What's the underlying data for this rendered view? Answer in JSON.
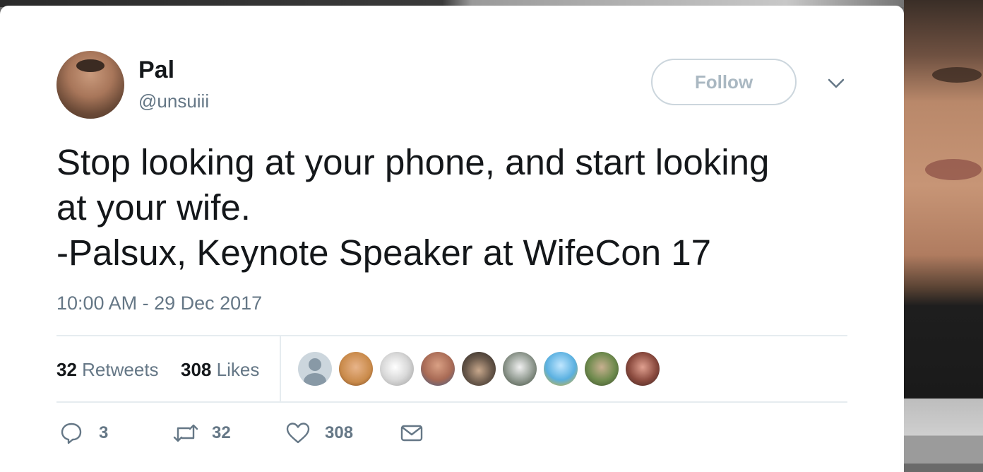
{
  "tweet": {
    "display_name": "Pal",
    "handle": "@unsuiii",
    "follow_label": "Follow",
    "text": "Stop looking at your phone, and start looking\nat your wife.\n-Palsux, Keynote Speaker at WifeCon 17",
    "timestamp": "10:00 AM - 29 Dec 2017"
  },
  "stats": {
    "retweets_count": "32",
    "retweets_label": "Retweets",
    "likes_count": "308",
    "likes_label": "Likes"
  },
  "likers": [
    {
      "avatar": "default-profile",
      "color": "#ccd6dd"
    },
    {
      "avatar": "face-1",
      "color": "#c98a4a"
    },
    {
      "avatar": "sketch-drawing",
      "color": "#d8d8d8"
    },
    {
      "avatar": "face-2",
      "color": "#a86a55"
    },
    {
      "avatar": "face-cap",
      "color": "#4a4540"
    },
    {
      "avatar": "cartoon-bw",
      "color": "#7d8a7a"
    },
    {
      "avatar": "cartoon-blue",
      "color": "#5ab0e0"
    },
    {
      "avatar": "outdoor-photo",
      "color": "#6e8a4d"
    },
    {
      "avatar": "face-3",
      "color": "#8a4a3e"
    }
  ],
  "actions": {
    "reply_count": "3",
    "retweet_count": "32",
    "like_count": "308"
  },
  "colors": {
    "text_primary": "#14171a",
    "text_secondary": "#657786",
    "border": "#e6ecf0",
    "follow_border": "#ccd6dd"
  }
}
